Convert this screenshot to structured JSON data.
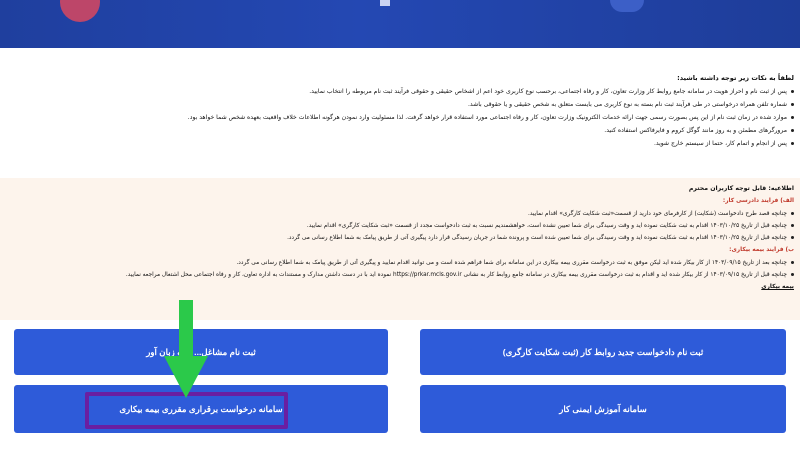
{
  "notice": {
    "heading": "لطفاً به نکات زیر توجه داشته باشید:",
    "items": [
      "پس از ثبت نام و احراز هویت در سامانه جامع روابط کار وزارت تعاون، کار و رفاه اجتماعی، برحسب نوع کاربری خود اعم از اشخاص حقیقی و حقوقی فرآیند ثبت نام مربوطه را انتخاب نمایید.",
      "شماره تلفن همراه درخواستی در طی فرآیند ثبت نام بسته به نوع کاربری می بایست متعلق به شخص حقیقی و یا حقوقی باشد.",
      "موارد شده در زمان ثبت نام از این پس بصورت رسمی جهت ارائه خدمات الکترونیک وزارت تعاون، کار و رفاه اجتماعی مورد استفاده قرار خواهد گرفت. لذا مسئولیت وارد نمودن هرگونه اطلاعات خلاف واقعیت بعهده شخص شما خواهد بود.",
      "مرورگرهای مطمئن و به روز مانند گوگل کروم و فایرفاکس استفاده کنید.",
      "پس از انجام و اتمام کار، حتما از سیستم خارج شوید."
    ]
  },
  "alert": {
    "heading": "اطلاعیه: قابل توجه کاربران محترم",
    "section_a": "الف) فرایند دادرسی کار:",
    "section_a_items": [
      "چنانچه قصد طرح دادخواست (شکایت) از کارفرمای خود دارید از قسمت«ثبت شکایت کارگری» اقدام نمایید.",
      "چنانچه قبل از تاریخ ۱۴۰۳/۱۰/۲۵ اقدام به ثبت شکایت نموده اید و وقت رسیدگی برای شما تعیین نشده است، خواهشمندیم نسبت به ثبت دادخواست مجدد از قسمت «ثبت شکایت کارگری» اقدام نمایید.",
      "چنانچه قبل از تاریخ ۱۴۰۳/۱۰/۲۵ اقدام به ثبت شکایت نموده اید و وقت رسیدگی برای شما تعیین شده است و پرونده شما در جریان رسیدگی قرار دارد پیگیری آتی از طریق پیامک به شما اطلاع رسانی می گردد."
    ],
    "section_b": "ب) فرایند بیمه بیکاری:",
    "section_b_items": [
      "چنانچه بعد از تاریخ ۱۴۰۳/۰۹/۱۵ از کار بیکار شده اید لیکن موفق به ثبت درخواست مقرری بیمه بیکاری در این سامانه برای شما فراهم شده است و می توانید اقدام نمایید و پیگیری آتی از طریق پیامک به شما اطلاع رسانی می گردد.",
      "چنانچه قبل از تاریخ ۱۴۰۳/۰۹/۱۵ از کار بیکار شده اید و اقدام به ثبت درخواست مقرری بیمه بیکاری در سامانه جامع روابط کار به نشانی https://prkar.mcls.gov.ir نموده اید با در دست داشتن مدارک و مستندات به اداره تعاون، کار و رفاه اجتماعی محل اشتغال مراجعه نمایید."
    ],
    "section_b_tail": "بیمه بیکاری"
  },
  "buttons": {
    "labor_complaint": "ثبت نام دادخواست جدید روابط کار (ثبت شکایت کارگری)",
    "translator": "ثبت نام مشاغل... ت و زبان آور",
    "safety_training": "سامانه آموزش ایمنی کار",
    "unemployment_insurance": "سامانه درخواست برقراری مقرری بیمه بیکاری"
  },
  "colors": {
    "banner": "#2448b3",
    "button": "#2e5bd9",
    "highlight": "#6a1fa1",
    "arrow": "#2bc94a",
    "alert_bg": "#fdf4ec",
    "alert_subheading": "#c0392b"
  }
}
